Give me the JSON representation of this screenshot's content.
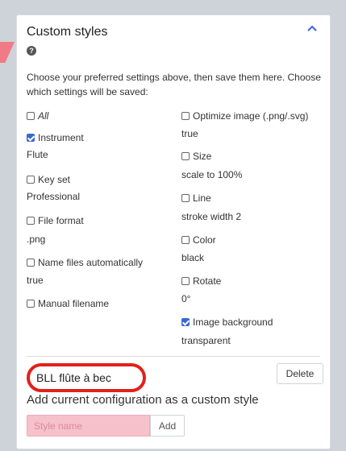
{
  "panel": {
    "title": "Custom styles",
    "help_icon": "?",
    "intro": "Choose your preferred settings above, then save them here. Choose which settings will be saved:"
  },
  "options": {
    "all": {
      "label": "All",
      "checked": false
    },
    "instrument": {
      "label": "Instrument",
      "value": "Flute",
      "checked": true
    },
    "key_set": {
      "label": "Key set",
      "value": "Professional",
      "checked": false
    },
    "file_format": {
      "label": "File format",
      "value": ".png",
      "checked": false
    },
    "name_files": {
      "label": "Name files automatically",
      "value": "true",
      "checked": false
    },
    "manual_filename": {
      "label": "Manual filename",
      "checked": false
    },
    "optimize_image": {
      "label": "Optimize image (.png/.svg)",
      "value": "true",
      "checked": false
    },
    "size": {
      "label": "Size",
      "value": "scale to 100%",
      "checked": false
    },
    "line": {
      "label": "Line",
      "value": "stroke width 2",
      "checked": false
    },
    "color": {
      "label": "Color",
      "value": "black",
      "checked": false
    },
    "rotate": {
      "label": "Rotate",
      "value": "0°",
      "checked": false
    },
    "image_background": {
      "label": "Image background",
      "value": "transparent",
      "checked": true
    }
  },
  "saved_style": {
    "name": "BLL flûte à bec",
    "delete_label": "Delete"
  },
  "add": {
    "title": "Add current configuration as a custom style",
    "placeholder": "Style name",
    "button_label": "Add"
  },
  "colors": {
    "accent": "#3a67d6",
    "highlight_ring": "#e0211c",
    "input_error_bg": "#f7c1cb"
  }
}
